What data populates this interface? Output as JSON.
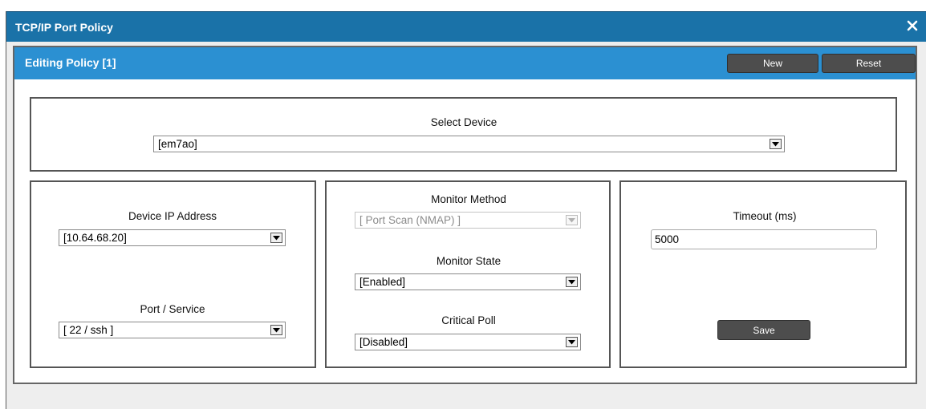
{
  "window": {
    "title": "TCP/IP Port Policy",
    "close_icon": "close-icon"
  },
  "panel": {
    "title": "Editing Policy [1]",
    "buttons": {
      "new_label": "New",
      "reset_label": "Reset"
    }
  },
  "device": {
    "label": "Select Device",
    "value": "[em7ao]"
  },
  "left": {
    "ip_label": "Device IP Address",
    "ip_value": "[10.64.68.20]",
    "port_label": "Port / Service",
    "port_value": "[ 22 / ssh ]"
  },
  "middle": {
    "method_label": "Monitor Method",
    "method_value": "[ Port Scan (NMAP) ]",
    "state_label": "Monitor State",
    "state_value": "[Enabled]",
    "critical_label": "Critical Poll",
    "critical_value": "[Disabled]"
  },
  "right": {
    "timeout_label": "Timeout (ms)",
    "timeout_value": "5000",
    "save_label": "Save"
  },
  "colors": {
    "titlebar": "#1a72a8",
    "panel_header": "#2b90d2",
    "button_bg": "#4d4d4d"
  }
}
